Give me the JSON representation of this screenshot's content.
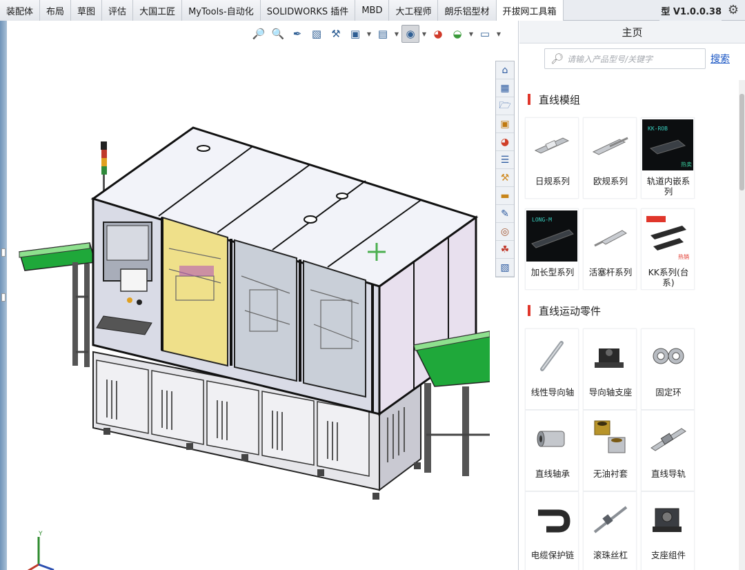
{
  "tabs": [
    {
      "label": "装配体",
      "active": false
    },
    {
      "label": "布局",
      "active": false
    },
    {
      "label": "草图",
      "active": false
    },
    {
      "label": "评估",
      "active": false
    },
    {
      "label": "大国工匠",
      "active": false
    },
    {
      "label": "MyTools-自动化",
      "active": false
    },
    {
      "label": "SOLIDWORKS 插件",
      "active": false
    },
    {
      "label": "MBD",
      "active": false
    },
    {
      "label": "大工程师",
      "active": false
    },
    {
      "label": "朗乐铝型材",
      "active": false
    },
    {
      "label": "开拔网工具箱",
      "active": true
    }
  ],
  "version_text": "型 V1.0.0.38",
  "panel": {
    "title": "主页",
    "search_placeholder": "请输入产品型号/关键字",
    "search_button": "搜索"
  },
  "sections": [
    {
      "title": "直线模组",
      "items": [
        {
          "label": "日规系列",
          "thumb": "linear-module-light"
        },
        {
          "label": "欧规系列",
          "thumb": "linear-module-screw"
        },
        {
          "label": "轨道内嵌系列",
          "thumb": "embedded-rail-dark",
          "badge": "热卖"
        },
        {
          "label": "加长型系列",
          "thumb": "long-module-dark"
        },
        {
          "label": "活塞杆系列",
          "thumb": "piston-rod"
        },
        {
          "label": "KK系列(台系)",
          "thumb": "kk-module",
          "badge": "热销"
        }
      ]
    },
    {
      "title": "直线运动零件",
      "items": [
        {
          "label": "线性导向轴",
          "thumb": "guide-shaft"
        },
        {
          "label": "导向轴支座",
          "thumb": "shaft-support"
        },
        {
          "label": "固定环",
          "thumb": "fixing-ring"
        },
        {
          "label": "直线轴承",
          "thumb": "linear-bearing"
        },
        {
          "label": "无油衬套",
          "thumb": "oilless-bushing"
        },
        {
          "label": "直线导轨",
          "thumb": "linear-guide"
        },
        {
          "label": "电缆保护链",
          "thumb": "cable-chain"
        },
        {
          "label": "滚珠丝杠",
          "thumb": "ball-screw"
        },
        {
          "label": "支座组件",
          "thumb": "support-unit"
        }
      ]
    }
  ],
  "view_toolbar_icons": [
    "zoom-to-fit-icon",
    "zoom-to-area-icon",
    "previous-view-icon",
    "section-view-icon",
    "dynamic-annotation-icon",
    "view-orientation-icon",
    "display-style-icon",
    "hide-show-items-icon",
    "edit-appearance-icon",
    "apply-scene-icon",
    "view-settings-icon"
  ],
  "side_toolbar_icons": [
    "home-icon",
    "3d-parts-icon",
    "open-folder-icon",
    "design-library-icon",
    "appearances-icon",
    "properties-list-icon",
    "toolbox-icon",
    "file-explorer-icon",
    "custom-properties-icon",
    "view-palette-icon",
    "decals-icon",
    "palette-icon"
  ]
}
